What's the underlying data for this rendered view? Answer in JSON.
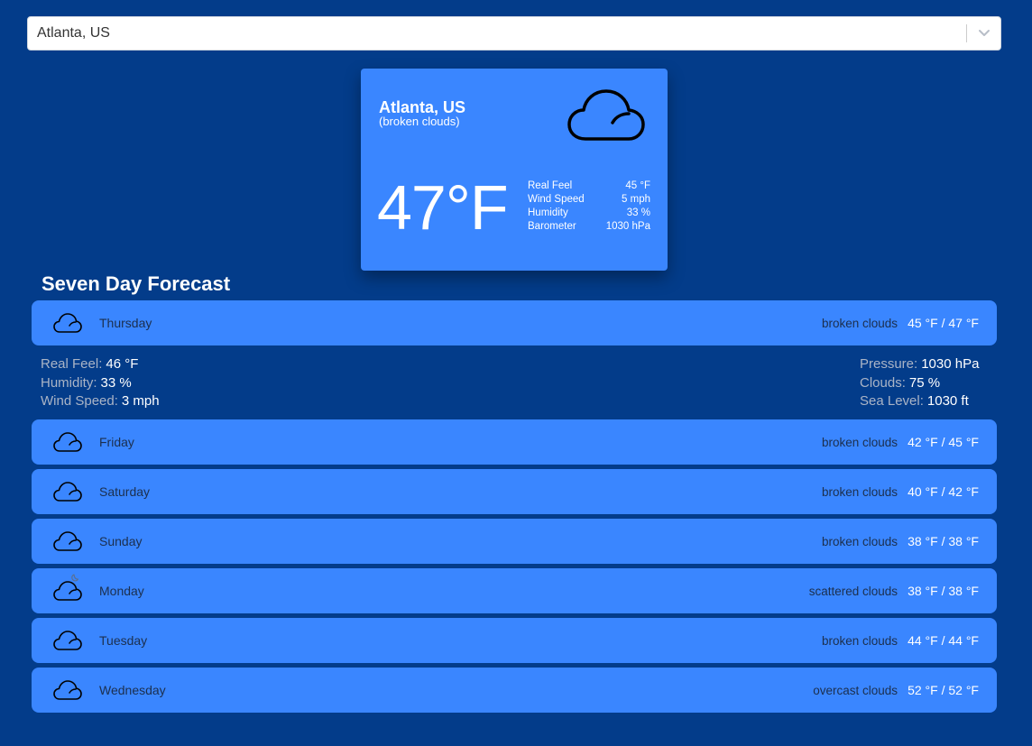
{
  "search": {
    "value": "Atlanta, US"
  },
  "current": {
    "city": "Atlanta, US",
    "description": "(broken clouds)",
    "temperature": "47°F",
    "icon": "cloud-icon",
    "details": [
      {
        "label": "Real Feel",
        "value": "45 °F"
      },
      {
        "label": "Wind Speed",
        "value": "5 mph"
      },
      {
        "label": "Humidity",
        "value": "33 %"
      },
      {
        "label": "Barometer",
        "value": "1030 hPa"
      }
    ]
  },
  "forecast_title": "Seven Day Forecast",
  "expanded": {
    "left": [
      {
        "label": "Real Feel:",
        "value": "46 °F"
      },
      {
        "label": "Humidity:",
        "value": "33 %"
      },
      {
        "label": "Wind Speed:",
        "value": "3 mph"
      }
    ],
    "right": [
      {
        "label": "Pressure:",
        "value": "1030 hPa"
      },
      {
        "label": "Clouds:",
        "value": "75 %"
      },
      {
        "label": "Sea Level:",
        "value": "1030 ft"
      }
    ]
  },
  "days": [
    {
      "name": "Thursday",
      "condition": "broken clouds",
      "range": "45 °F / 47 °F",
      "icon": "cloud-icon"
    },
    {
      "name": "Friday",
      "condition": "broken clouds",
      "range": "42 °F / 45 °F",
      "icon": "cloud-icon"
    },
    {
      "name": "Saturday",
      "condition": "broken clouds",
      "range": "40 °F / 42 °F",
      "icon": "cloud-icon"
    },
    {
      "name": "Sunday",
      "condition": "broken clouds",
      "range": "38 °F / 38 °F",
      "icon": "cloud-icon"
    },
    {
      "name": "Monday",
      "condition": "scattered clouds",
      "range": "38 °F / 38 °F",
      "icon": "cloud-moon-icon"
    },
    {
      "name": "Tuesday",
      "condition": "broken clouds",
      "range": "44 °F / 44 °F",
      "icon": "cloud-icon"
    },
    {
      "name": "Wednesday",
      "condition": "overcast clouds",
      "range": "52 °F / 52 °F",
      "icon": "cloud-icon"
    }
  ],
  "colors": {
    "background": "#033c8a",
    "card": "#3a86ff",
    "text_dark": "#1c2f4d",
    "label_muted": "#aab4c6"
  }
}
